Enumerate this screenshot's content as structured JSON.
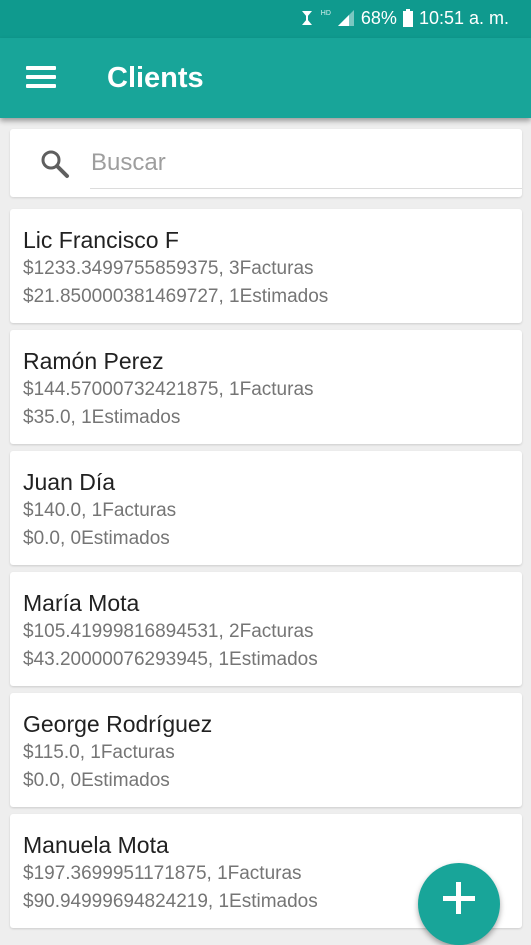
{
  "status_bar": {
    "network_label": "HD",
    "battery_percent": "68%",
    "time": "10:51 a. m."
  },
  "app_bar": {
    "title": "Clients",
    "menu_icon": "hamburger-menu-icon"
  },
  "search": {
    "placeholder": "Buscar",
    "value": "",
    "icon": "search-icon"
  },
  "clients": [
    {
      "name": "Lic Francisco F",
      "invoices_line": "$1233.3499755859375, 3Facturas",
      "estimates_line": "$21.850000381469727, 1Estimados"
    },
    {
      "name": "Ramón Perez",
      "invoices_line": "$144.57000732421875, 1Facturas",
      "estimates_line": "$35.0, 1Estimados"
    },
    {
      "name": "Juan Día",
      "invoices_line": "$140.0, 1Facturas",
      "estimates_line": "$0.0, 0Estimados"
    },
    {
      "name": "María Mota",
      "invoices_line": "$105.41999816894531, 2Facturas",
      "estimates_line": "$43.20000076293945, 1Estimados"
    },
    {
      "name": "George Rodríguez",
      "invoices_line": "$115.0, 1Facturas",
      "estimates_line": "$0.0, 0Estimados"
    },
    {
      "name": "Manuela Mota",
      "invoices_line": "$197.3699951171875, 1Facturas",
      "estimates_line": "$90.94999694824219, 1Estimados"
    }
  ],
  "fab": {
    "icon": "plus-icon"
  },
  "colors": {
    "primary": "#18a599",
    "primary_dark": "#0f9a8e",
    "background": "#eeeeee",
    "card": "#ffffff",
    "text_primary": "#212121",
    "text_secondary": "#757575"
  }
}
